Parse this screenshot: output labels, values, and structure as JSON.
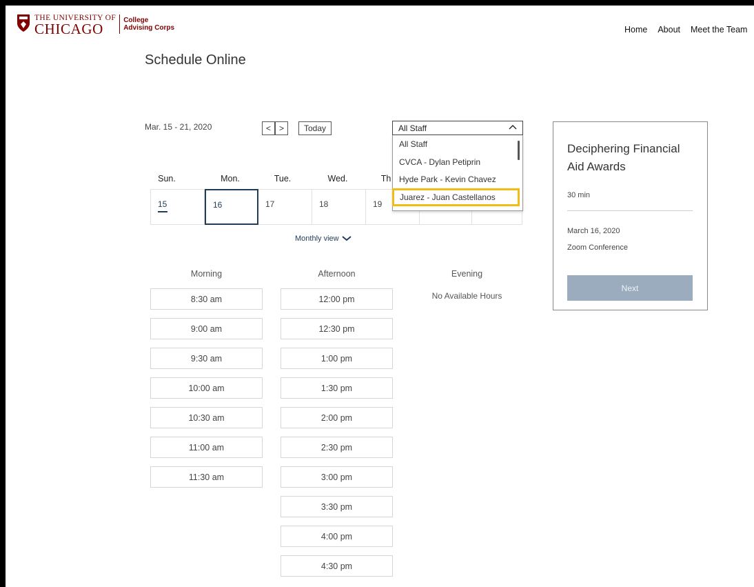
{
  "header": {
    "logo_top": "THE UNIVERSITY OF",
    "logo_bottom": "CHICAGO",
    "logo_sub1": "College",
    "logo_sub2": "Advising Corps",
    "nav": [
      "Home",
      "About",
      "Meet the Team"
    ]
  },
  "page": {
    "title": "Schedule Online"
  },
  "calendar": {
    "range": "Mar. 15 - 21, 2020",
    "prev_label": "<",
    "next_label": ">",
    "today_label": "Today",
    "days_of_week": [
      "Sun.",
      "Mon.",
      "Tue.",
      "Wed.",
      "Th"
    ],
    "dates": [
      "15",
      "16",
      "17",
      "18",
      "19"
    ],
    "monthly_view": "Monthly view"
  },
  "staff": {
    "selected": "All Staff",
    "options": [
      "All Staff",
      "CVCA - Dylan Petiprin",
      "Hyde Park - Kevin Chavez",
      "Juarez - Juan Castellanos"
    ]
  },
  "slots": {
    "morning_label": "Morning",
    "afternoon_label": "Afternoon",
    "evening_label": "Evening",
    "morning": [
      "8:30 am",
      "9:00 am",
      "9:30 am",
      "10:00 am",
      "10:30 am",
      "11:00 am",
      "11:30 am"
    ],
    "afternoon": [
      "12:00 pm",
      "12:30 pm",
      "1:00 pm",
      "1:30 pm",
      "2:00 pm",
      "2:30 pm",
      "3:00 pm",
      "3:30 pm",
      "4:00 pm",
      "4:30 pm"
    ],
    "evening_empty": "No Available Hours"
  },
  "summary": {
    "service": "Deciphering Financial Aid Awards",
    "duration": "30 min",
    "date": "March 16, 2020",
    "location": "Zoom Conference",
    "next_label": "Next"
  },
  "colors": {
    "brand": "#800000",
    "accent": "#1f3b57",
    "highlight": "#f2bc16",
    "next_button": "#9aacbd"
  }
}
